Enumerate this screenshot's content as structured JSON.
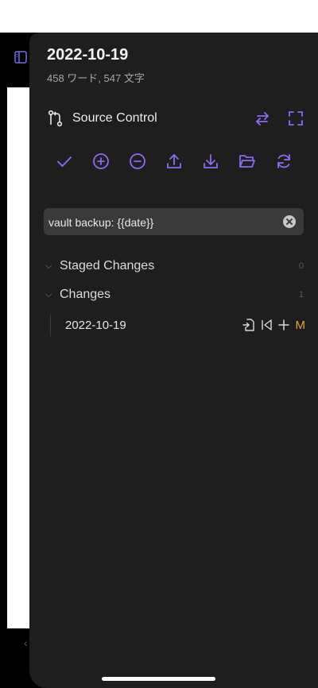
{
  "note": {
    "title": "2022-10-19",
    "stats": "458 ワード, 547 文字"
  },
  "source_control": {
    "label": "Source Control"
  },
  "commit": {
    "value": "vault backup: {{date}}"
  },
  "sections": {
    "staged": {
      "label": "Staged Changes",
      "count": "0"
    },
    "changes": {
      "label": "Changes",
      "count": "1"
    }
  },
  "changed_files": [
    {
      "name": "2022-10-19",
      "status": "M"
    }
  ],
  "icons": {
    "toolbar": [
      "check-icon",
      "plus-circle-icon",
      "minus-circle-icon",
      "upload-icon",
      "download-icon",
      "folder-open-icon",
      "refresh-icon"
    ],
    "header_right": [
      "swap-arrows-icon",
      "expand-icon"
    ],
    "file_actions": [
      "open-file-icon",
      "skip-back-icon",
      "plus-icon"
    ]
  },
  "colors": {
    "accent": "#8b6cf0",
    "modified": "#e2a53b",
    "panel_bg": "#1e1e1e"
  }
}
